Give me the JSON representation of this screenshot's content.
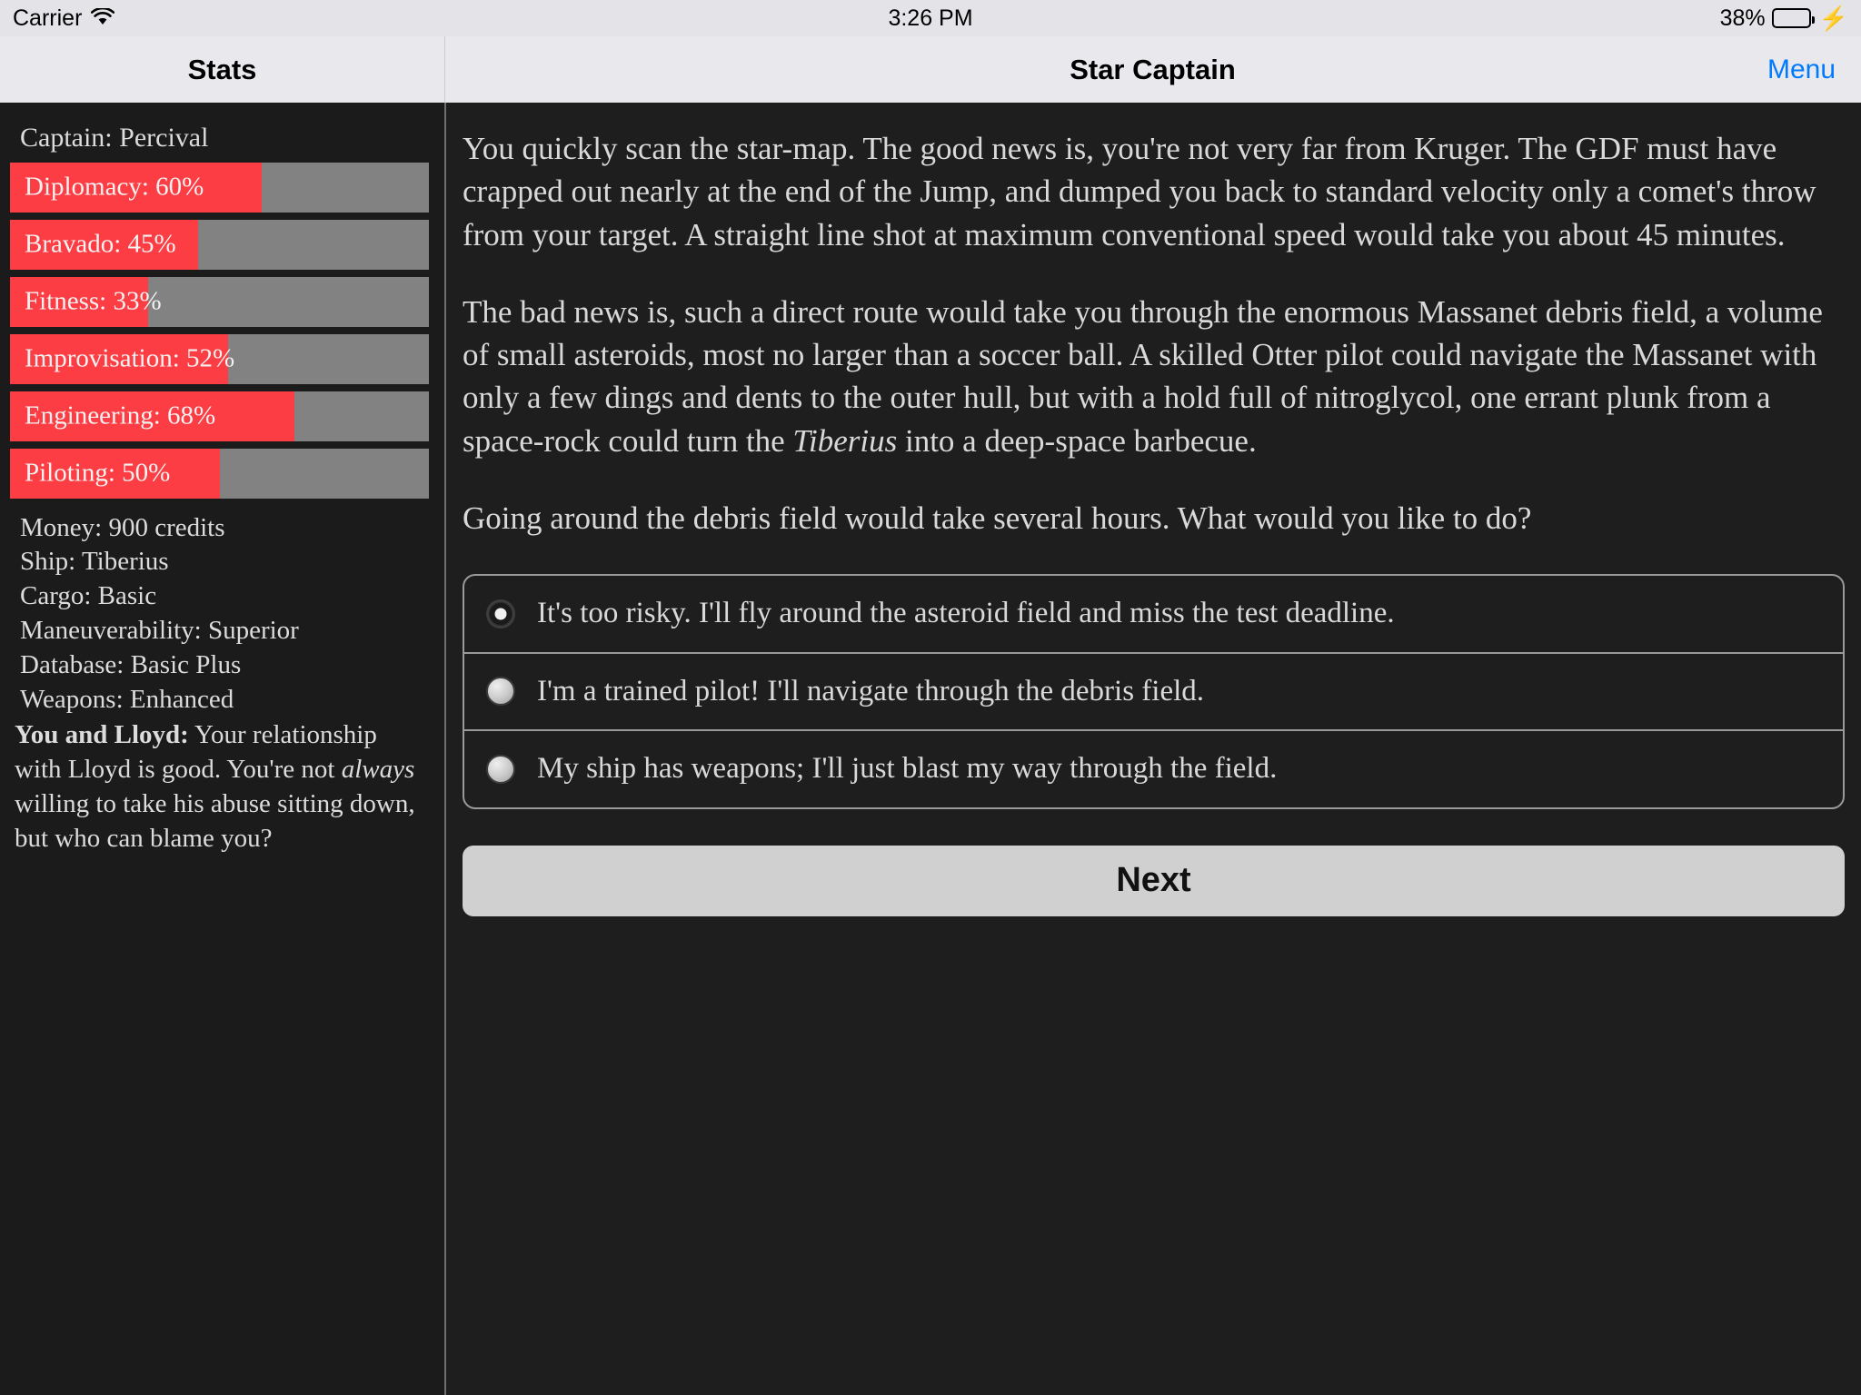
{
  "status_bar": {
    "carrier": "Carrier",
    "wifi_icon": "wifi-icon",
    "time": "3:26 PM",
    "battery_percent": "38%",
    "battery_level": 38,
    "battery_color": "#4cd964",
    "charging_icon": "⚡"
  },
  "nav": {
    "left_title": "Stats",
    "right_title": "Star Captain",
    "menu_label": "Menu",
    "menu_color": "#007aff"
  },
  "sidebar": {
    "captain_line": "Captain: Percival",
    "stat_fill_color": "#fc3d44",
    "stat_track_color": "#828282",
    "stats": [
      {
        "label": "Diplomacy: 60%",
        "name": "Diplomacy",
        "value": 60
      },
      {
        "label": "Bravado: 45%",
        "name": "Bravado",
        "value": 45
      },
      {
        "label": "Fitness: 33%",
        "name": "Fitness",
        "value": 33
      },
      {
        "label": "Improvisation: 52%",
        "name": "Improvisation",
        "value": 52
      },
      {
        "label": "Engineering: 68%",
        "name": "Engineering",
        "value": 68
      },
      {
        "label": "Piloting: 50%",
        "name": "Piloting",
        "value": 50
      }
    ],
    "info": [
      "Money: 900 credits",
      "Ship: Tiberius",
      "Cargo: Basic",
      "Maneuverability: Superior",
      "Database: Basic Plus",
      "Weapons: Enhanced"
    ],
    "relationship": {
      "heading": "You and Lloyd:",
      "text_before": " Your relationship with Lloyd is good. You're not ",
      "emphasis": "always",
      "text_after": " willing to take his abuse sitting down, but who can blame you?"
    }
  },
  "story": {
    "paragraph_1": "You quickly scan the star-map. The good news is, you're not very far from Kruger. The GDF must have crapped out nearly at the end of the Jump, and dumped you back to standard velocity only a comet's throw from your target. A straight line shot at maximum conventional speed would take you about 45 minutes.",
    "paragraph_2_before": "The bad news is, such a direct route would take you through the enormous Massanet debris field, a volume of small asteroids, most no larger than a soccer ball. A skilled Otter pilot could navigate the Massanet with only a few dings and dents to the outer hull, but with a hold full of nitroglycol, one errant plunk from a space-rock could turn the ",
    "paragraph_2_emphasis": "Tiberius",
    "paragraph_2_after": " into a deep-space barbecue.",
    "paragraph_3": "Going around the debris field would take several hours. What would you like to do?"
  },
  "choices": [
    {
      "label": "It's too risky. I'll fly around the asteroid field and miss the test deadline.",
      "selected": true
    },
    {
      "label": "I'm a trained pilot! I'll navigate through the debris field.",
      "selected": false
    },
    {
      "label": "My ship has weapons; I'll just blast my way through the field.",
      "selected": false
    }
  ],
  "next_button": {
    "label": "Next"
  }
}
